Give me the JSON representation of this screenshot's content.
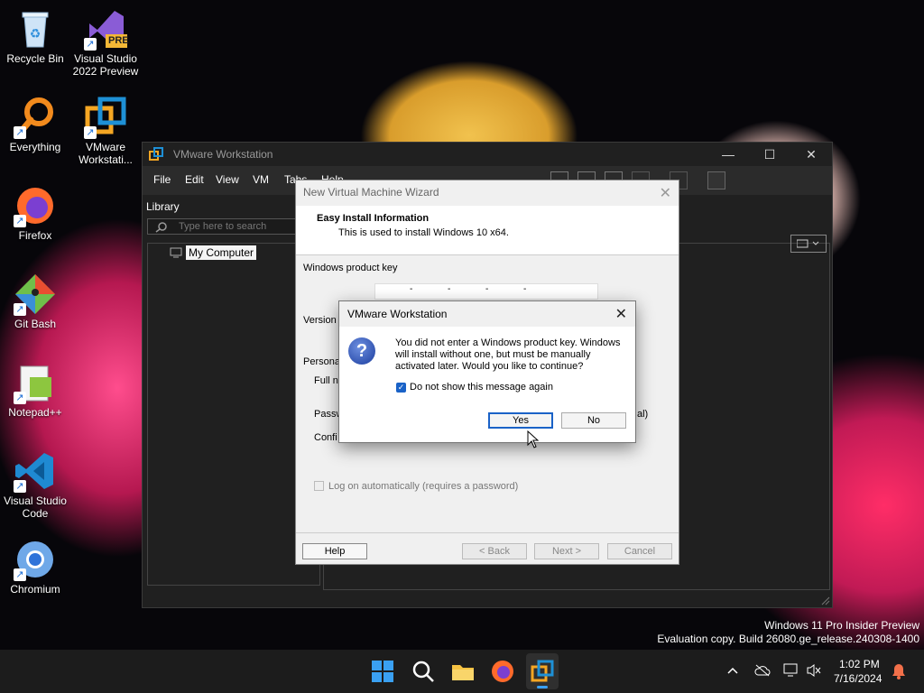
{
  "desktop": {
    "icons": [
      {
        "label": "Recycle Bin",
        "icon": "recycle-bin-icon"
      },
      {
        "label": "Visual Studio 2022 Preview",
        "icon": "visual-studio-preview-icon",
        "badge": "PRE"
      },
      {
        "label": "Everything",
        "icon": "everything-search-icon"
      },
      {
        "label": "VMware Workstati...",
        "icon": "vmware-icon"
      },
      {
        "label": "Firefox",
        "icon": "firefox-icon"
      },
      {
        "label": "Git Bash",
        "icon": "git-bash-icon"
      },
      {
        "label": "Notepad++",
        "icon": "notepad-plus-plus-icon"
      },
      {
        "label": "Visual Studio Code",
        "icon": "vscode-icon"
      },
      {
        "label": "Chromium",
        "icon": "chromium-icon"
      }
    ]
  },
  "vmware": {
    "title": "VMware Workstation",
    "menu": [
      "File",
      "Edit",
      "View",
      "VM",
      "Tabs",
      "Help"
    ],
    "library_title": "Library",
    "search_placeholder": "Type here to search",
    "tree_item": "My Computer"
  },
  "wizard": {
    "title": "New Virtual Machine Wizard",
    "heading": "Easy Install Information",
    "subheading": "This is used to install Windows 10 x64.",
    "product_key_label": "Windows product key",
    "key_separator": "-",
    "version_label": "Version o",
    "personalize_label": "Persona",
    "full_name_label": "Full na",
    "password_label": "Passw",
    "password_suffix": "al)",
    "confirm_label": "Confi",
    "autologon_label": "Log on automatically (requires a password)",
    "buttons": {
      "help": "Help",
      "back": "< Back",
      "next": "Next >",
      "cancel": "Cancel"
    }
  },
  "dialog": {
    "title": "VMware Workstation",
    "message": "You did not enter a Windows product key. Windows will install without one, but must be manually activated later. Would you like to continue?",
    "checkbox_label": "Do not show this message again",
    "checkbox_checked": true,
    "yes": "Yes",
    "no": "No"
  },
  "watermark": {
    "line1": "Windows 11 Pro Insider Preview",
    "line2": "Evaluation copy. Build 26080.ge_release.240308-1400"
  },
  "taskbar": {
    "time": "1:02 PM",
    "date": "7/16/2024",
    "apps": [
      "start-icon",
      "search-icon",
      "file-explorer-icon",
      "firefox-icon",
      "vmware-icon"
    ]
  },
  "colors": {
    "accent": "#1a62c7",
    "vmware_dark": "#202020"
  }
}
